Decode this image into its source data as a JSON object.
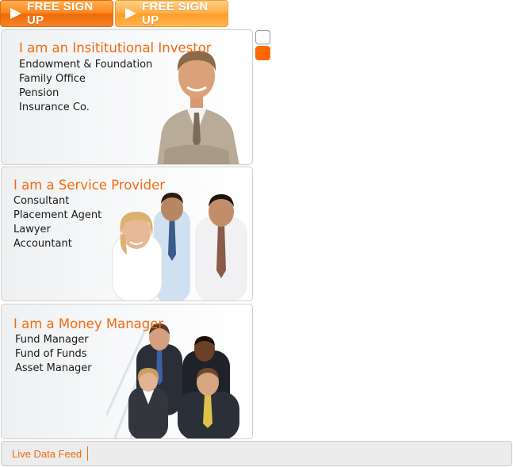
{
  "signup_buttons": [
    {
      "label": "FREE SIGN UP"
    },
    {
      "label": "FREE SIGN UP"
    }
  ],
  "panels": [
    {
      "title": "I am an Insititutional Investor",
      "items": [
        "Endowment & Foundation",
        "Family Office",
        "Pension",
        "Insurance Co."
      ]
    },
    {
      "title": "I am a Service Provider",
      "items": [
        "Consultant",
        "Placement Agent",
        "Lawyer",
        "Accountant"
      ]
    },
    {
      "title": "I am a Money Manager",
      "items": [
        "Fund Manager",
        "Fund of Funds",
        "Asset Manager"
      ]
    }
  ],
  "footer": {
    "label": "Live Data Feed"
  },
  "colors": {
    "accent": "#f26b0f",
    "active_nav": "#ff6a00"
  }
}
